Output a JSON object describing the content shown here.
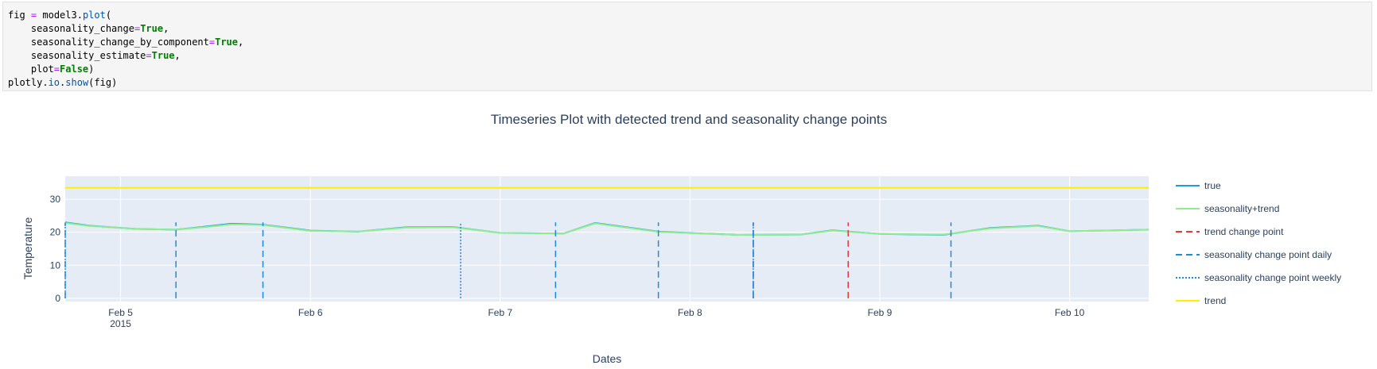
{
  "code": {
    "lines": [
      [
        {
          "t": "fig ",
          "c": ""
        },
        {
          "t": "=",
          "c": "op"
        },
        {
          "t": " model3.",
          "c": ""
        },
        {
          "t": "plot",
          "c": "fn"
        },
        {
          "t": "(",
          "c": ""
        }
      ],
      [
        {
          "t": "    seasonality_change",
          "c": ""
        },
        {
          "t": "=",
          "c": "op"
        },
        {
          "t": "True",
          "c": "kw"
        },
        {
          "t": ",",
          "c": ""
        }
      ],
      [
        {
          "t": "    seasonality_change_by_component",
          "c": ""
        },
        {
          "t": "=",
          "c": "op"
        },
        {
          "t": "True",
          "c": "kw"
        },
        {
          "t": ",",
          "c": ""
        }
      ],
      [
        {
          "t": "    seasonality_estimate",
          "c": ""
        },
        {
          "t": "=",
          "c": "op"
        },
        {
          "t": "True",
          "c": "kw"
        },
        {
          "t": ",",
          "c": ""
        }
      ],
      [
        {
          "t": "    plot",
          "c": ""
        },
        {
          "t": "=",
          "c": "op"
        },
        {
          "t": "False",
          "c": "kw"
        },
        {
          "t": ")",
          "c": ""
        }
      ],
      [
        {
          "t": "plotly.",
          "c": ""
        },
        {
          "t": "io",
          "c": "fn"
        },
        {
          "t": ".",
          "c": ""
        },
        {
          "t": "show",
          "c": "fn"
        },
        {
          "t": "(fig)",
          "c": ""
        }
      ]
    ]
  },
  "chart_data": {
    "type": "line",
    "title": "Timeseries Plot with detected trend and seasonality change points",
    "xlabel": "Dates",
    "ylabel": "Temperature",
    "x_range": [
      "2015-02-04 17:00",
      "2015-02-10 10:00"
    ],
    "ylim": [
      -1,
      37
    ],
    "x_ticks": [
      {
        "label": "Feb 5",
        "sub": "2015",
        "x": "2015-02-05 00:00"
      },
      {
        "label": "Feb 6",
        "sub": "",
        "x": "2015-02-06 00:00"
      },
      {
        "label": "Feb 7",
        "sub": "",
        "x": "2015-02-07 00:00"
      },
      {
        "label": "Feb 8",
        "sub": "",
        "x": "2015-02-08 00:00"
      },
      {
        "label": "Feb 9",
        "sub": "",
        "x": "2015-02-09 00:00"
      },
      {
        "label": "Feb 10",
        "sub": "",
        "x": "2015-02-10 00:00"
      }
    ],
    "y_ticks": [
      0,
      10,
      20,
      30
    ],
    "grid": true,
    "legend_position": "right",
    "colors": {
      "plot_bg": "#e5ecf6",
      "true": "#1f9bd7",
      "seasonality_trend": "#90ee90",
      "trend_change_point": "#e53935",
      "seasonality_change_point_daily": "#1e88e5",
      "seasonality_change_point_weekly": "#1e88e5",
      "trend": "#ffee00"
    },
    "series": [
      {
        "name": "true",
        "style": "solid",
        "points": [
          [
            "2015-02-04 17:00",
            23
          ],
          [
            "2015-02-04 20:00",
            22
          ],
          [
            "2015-02-05 02:00",
            21
          ],
          [
            "2015-02-05 07:00",
            20.8
          ],
          [
            "2015-02-05 10:00",
            21.5
          ],
          [
            "2015-02-05 14:00",
            22.6
          ],
          [
            "2015-02-05 18:00",
            22.3
          ],
          [
            "2015-02-06 00:00",
            20.5
          ],
          [
            "2015-02-06 06:00",
            20.2
          ],
          [
            "2015-02-06 12:00",
            21.5
          ],
          [
            "2015-02-06 18:00",
            21.6
          ],
          [
            "2015-02-07 00:00",
            19.8
          ],
          [
            "2015-02-07 08:00",
            19.6
          ],
          [
            "2015-02-07 12:00",
            22.8
          ],
          [
            "2015-02-07 16:00",
            21.5
          ],
          [
            "2015-02-07 20:00",
            20.2
          ],
          [
            "2015-02-08 06:00",
            19.2
          ],
          [
            "2015-02-08 14:00",
            19.3
          ],
          [
            "2015-02-08 18:00",
            20.6
          ],
          [
            "2015-02-09 00:00",
            19.5
          ],
          [
            "2015-02-09 08:00",
            19.2
          ],
          [
            "2015-02-09 14:00",
            21.3
          ],
          [
            "2015-02-09 20:00",
            22.0
          ],
          [
            "2015-02-10 00:00",
            20.3
          ],
          [
            "2015-02-10 10:00",
            20.8
          ]
        ]
      },
      {
        "name": "seasonality+trend",
        "style": "solid",
        "points": [
          [
            "2015-02-04 17:00",
            22.8
          ],
          [
            "2015-02-04 20:00",
            21.9
          ],
          [
            "2015-02-05 02:00",
            21.0
          ],
          [
            "2015-02-05 07:00",
            20.8
          ],
          [
            "2015-02-05 10:00",
            21.4
          ],
          [
            "2015-02-05 14:00",
            22.4
          ],
          [
            "2015-02-05 18:00",
            22.2
          ],
          [
            "2015-02-06 00:00",
            20.4
          ],
          [
            "2015-02-06 06:00",
            20.2
          ],
          [
            "2015-02-06 12:00",
            21.4
          ],
          [
            "2015-02-06 18:00",
            21.5
          ],
          [
            "2015-02-07 00:00",
            19.8
          ],
          [
            "2015-02-07 08:00",
            19.6
          ],
          [
            "2015-02-07 12:00",
            22.7
          ],
          [
            "2015-02-07 16:00",
            21.4
          ],
          [
            "2015-02-07 20:00",
            20.1
          ],
          [
            "2015-02-08 06:00",
            19.2
          ],
          [
            "2015-02-08 14:00",
            19.3
          ],
          [
            "2015-02-08 18:00",
            20.5
          ],
          [
            "2015-02-09 00:00",
            19.5
          ],
          [
            "2015-02-09 08:00",
            19.3
          ],
          [
            "2015-02-09 14:00",
            21.2
          ],
          [
            "2015-02-09 20:00",
            21.9
          ],
          [
            "2015-02-10 00:00",
            20.3
          ],
          [
            "2015-02-10 10:00",
            20.8
          ]
        ]
      },
      {
        "name": "trend change point",
        "style": "dash-red",
        "points": [
          [
            "2015-02-08 08:00",
            0
          ],
          [
            "2015-02-08 08:00",
            23
          ],
          [
            "2015-02-08 20:00",
            0
          ],
          [
            "2015-02-08 20:00",
            23
          ]
        ]
      },
      {
        "name": "seasonality change point daily",
        "style": "dash-blue",
        "points": [
          [
            "2015-02-04 17:00",
            0
          ],
          [
            "2015-02-05 07:00",
            0
          ],
          [
            "2015-02-05 18:00",
            0
          ],
          [
            "2015-02-07 07:00",
            0
          ],
          [
            "2015-02-07 20:00",
            0
          ],
          [
            "2015-02-08 08:00",
            0
          ],
          [
            "2015-02-09 09:00",
            0
          ]
        ]
      },
      {
        "name": "seasonality change point weekly",
        "style": "dot-blue",
        "points": [
          [
            "2015-02-04 17:00",
            0
          ],
          [
            "2015-02-06 19:00",
            0
          ],
          [
            "2015-02-08 08:00",
            0
          ]
        ]
      },
      {
        "name": "trend",
        "style": "solid-yellow",
        "points": [
          [
            "2015-02-04 17:00",
            33.5
          ],
          [
            "2015-02-10 10:00",
            33.5
          ]
        ]
      }
    ]
  }
}
